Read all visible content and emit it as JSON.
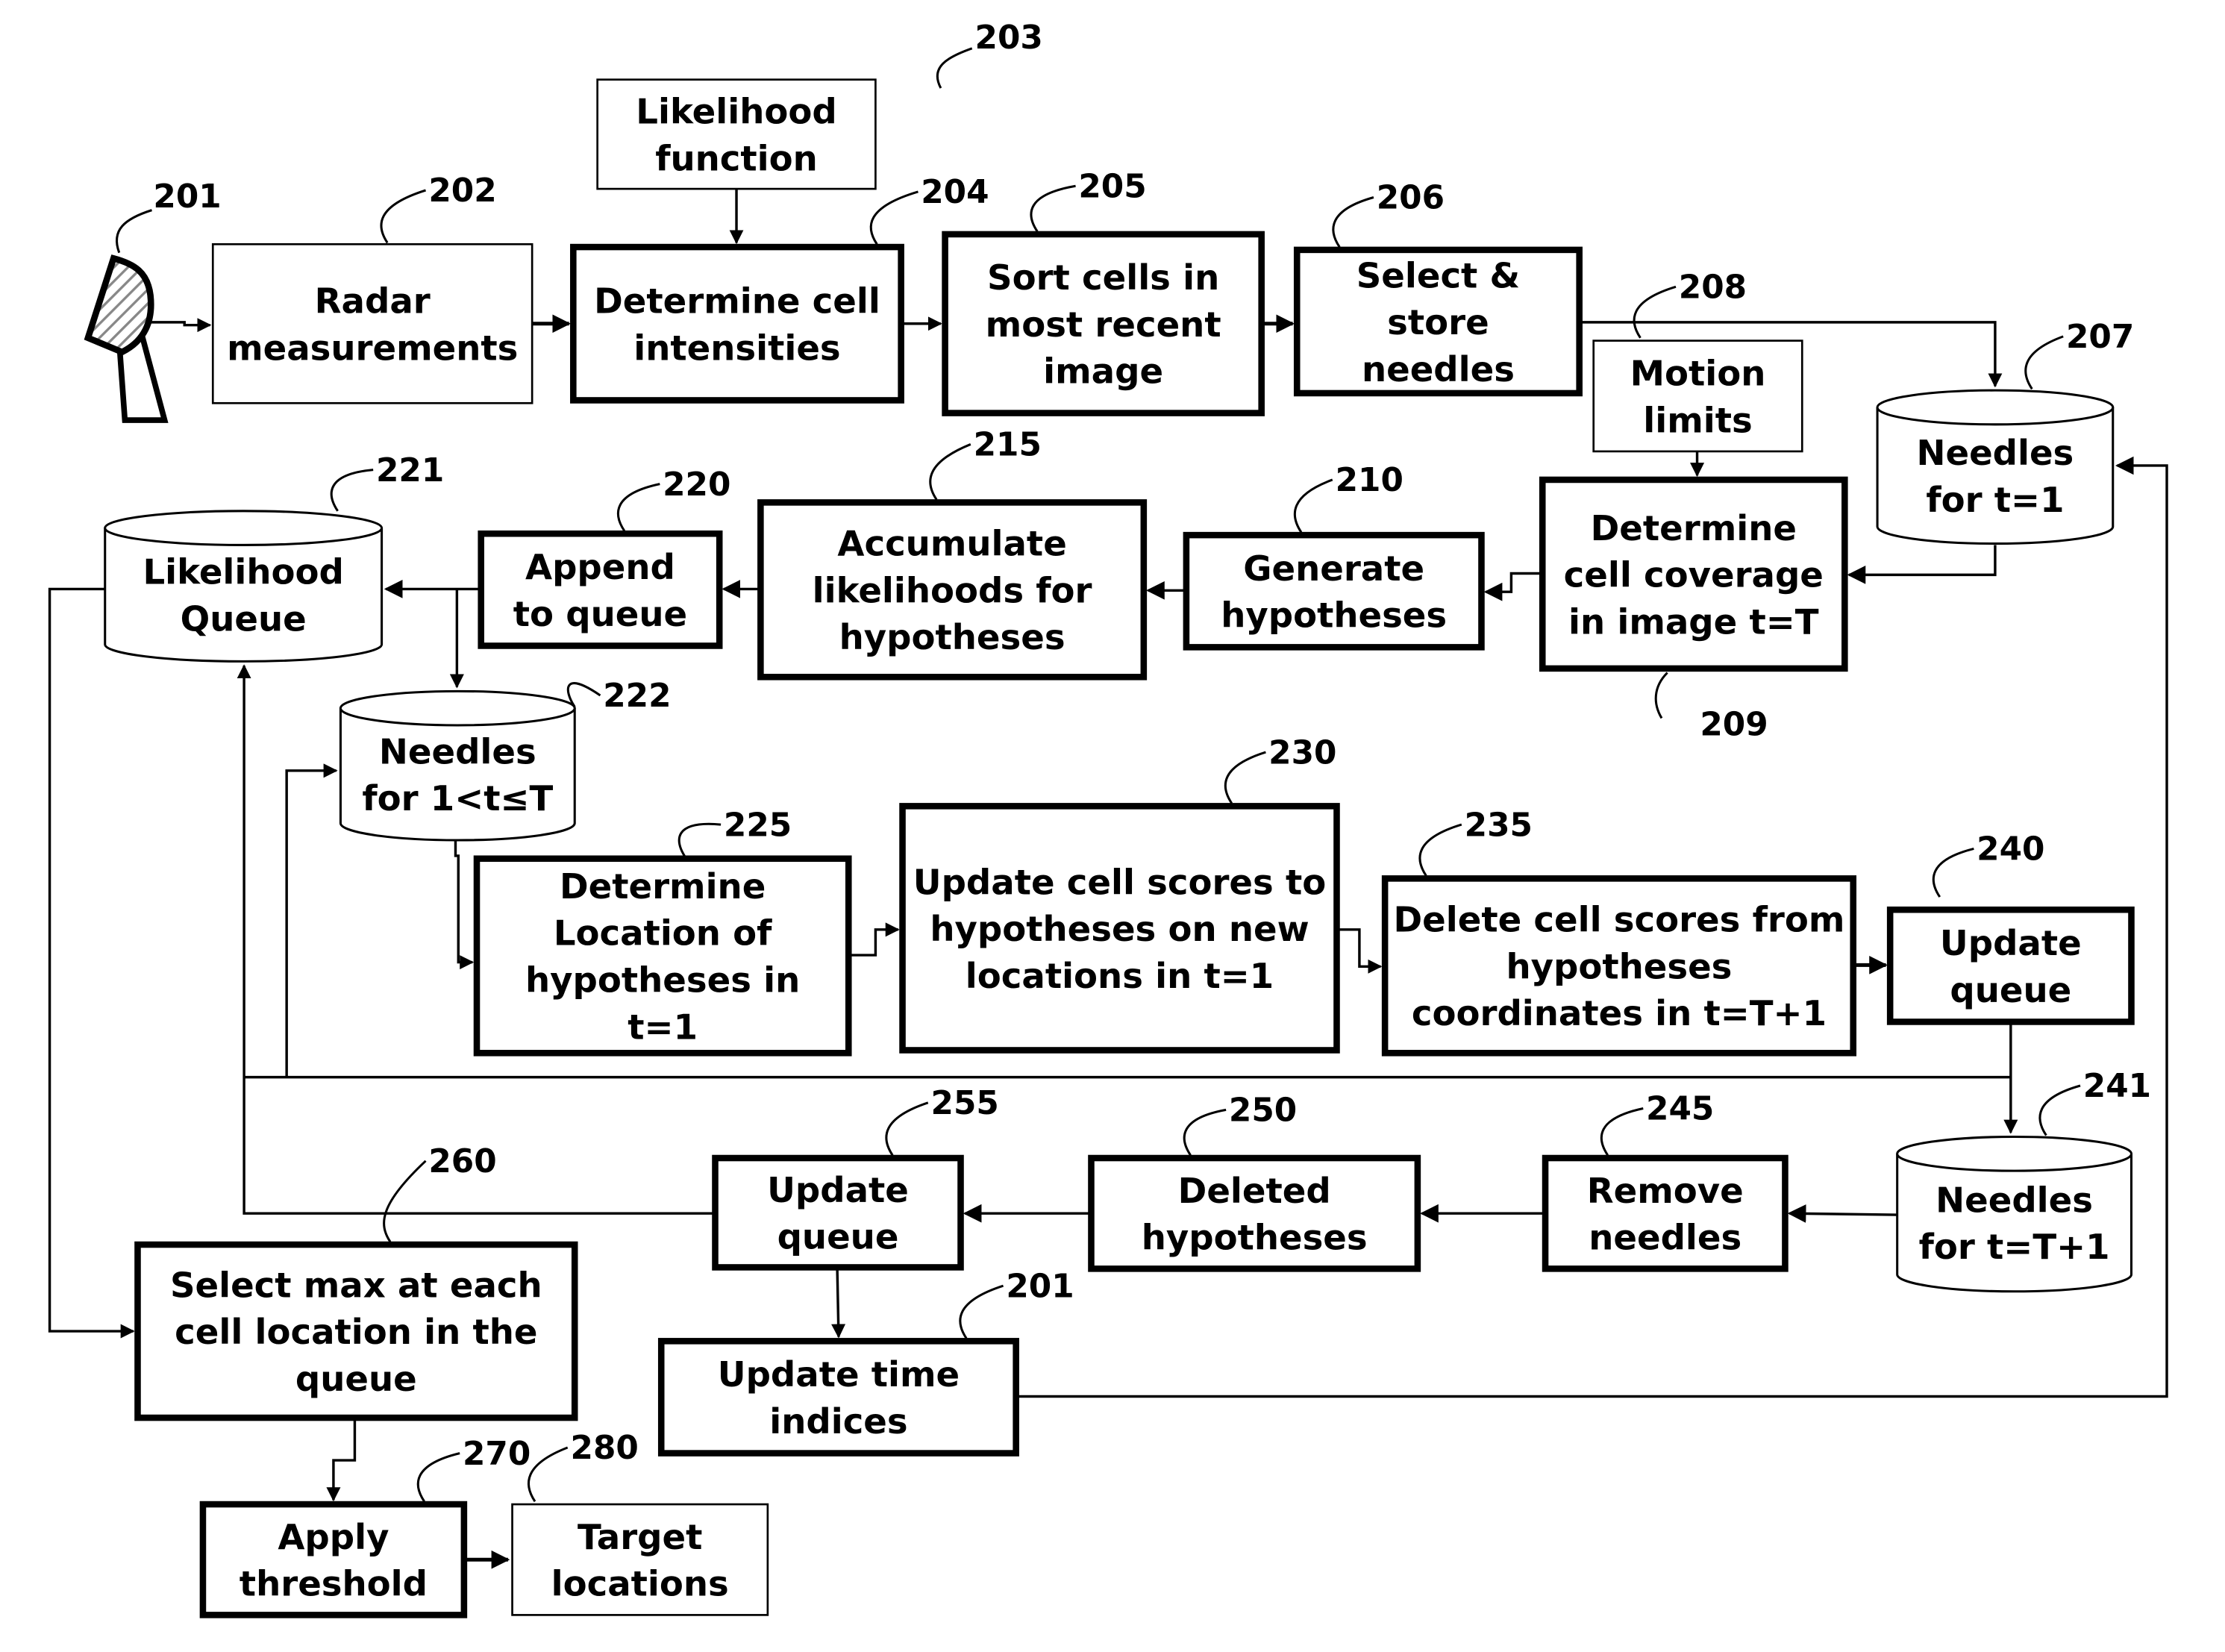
{
  "figure_ref": "203",
  "antenna": {
    "ref": "201",
    "icon": "radar-antenna-icon"
  },
  "nodes": {
    "likelihood_function": {
      "ref": "",
      "lines": [
        "Likelihood",
        "function"
      ]
    },
    "radar_measurements": {
      "ref": "202",
      "lines": [
        "Radar",
        "measurements"
      ]
    },
    "determine_cell_intensities": {
      "ref": "204",
      "lines": [
        "Determine cell",
        "intensities"
      ]
    },
    "sort_cells": {
      "ref": "205",
      "lines": [
        "Sort cells in",
        "most recent",
        "image"
      ]
    },
    "select_store_needles": {
      "ref": "206",
      "lines": [
        "Select &",
        "store",
        "needles"
      ]
    },
    "needles_t1": {
      "ref": "207",
      "lines": [
        "Needles",
        "for t=1"
      ]
    },
    "motion_limits": {
      "ref": "208",
      "lines": [
        "Motion",
        "limits"
      ]
    },
    "determine_cell_coverage": {
      "ref": "209",
      "lines": [
        "Determine",
        "cell coverage",
        "in image t=T"
      ]
    },
    "generate_hypotheses": {
      "ref": "210",
      "lines": [
        "Generate",
        "hypotheses"
      ]
    },
    "accumulate_likelihoods": {
      "ref": "215",
      "lines": [
        "Accumulate",
        "likelihoods for",
        "hypotheses"
      ]
    },
    "append_to_queue": {
      "ref": "220",
      "lines": [
        "Append",
        "to queue"
      ]
    },
    "likelihood_queue": {
      "ref": "221",
      "lines": [
        "Likelihood",
        "Queue"
      ]
    },
    "needles_1_t_T": {
      "ref": "222",
      "lines": [
        "Needles",
        "for 1<t≤T"
      ]
    },
    "determine_location": {
      "ref": "225",
      "lines": [
        "Determine",
        "Location of",
        "hypotheses in",
        "t=1"
      ]
    },
    "update_cell_scores": {
      "ref": "230",
      "lines": [
        "Update cell scores to",
        "hypotheses on new",
        "locations in t=1"
      ]
    },
    "delete_cell_scores": {
      "ref": "235",
      "lines": [
        "Delete cell scores from",
        "hypotheses",
        "coordinates in t=T+1"
      ]
    },
    "update_queue_240": {
      "ref": "240",
      "lines": [
        "Update",
        "queue"
      ]
    },
    "needles_tT1": {
      "ref": "241",
      "lines": [
        "Needles",
        "for t=T+1"
      ]
    },
    "remove_needles": {
      "ref": "245",
      "lines": [
        "Remove",
        "needles"
      ]
    },
    "deleted_hypotheses": {
      "ref": "250",
      "lines": [
        "Deleted",
        "hypotheses"
      ]
    },
    "update_queue_255": {
      "ref": "255",
      "lines": [
        "Update",
        "queue"
      ]
    },
    "update_time_indices": {
      "ref": "201",
      "lines": [
        "Update time",
        "indices"
      ]
    },
    "select_max": {
      "ref": "260",
      "lines": [
        "Select max at each",
        "cell location in the",
        "queue"
      ]
    },
    "apply_threshold": {
      "ref": "270",
      "lines": [
        "Apply",
        "threshold"
      ]
    },
    "target_locations": {
      "ref": "280",
      "lines": [
        "Target",
        "locations"
      ]
    }
  }
}
